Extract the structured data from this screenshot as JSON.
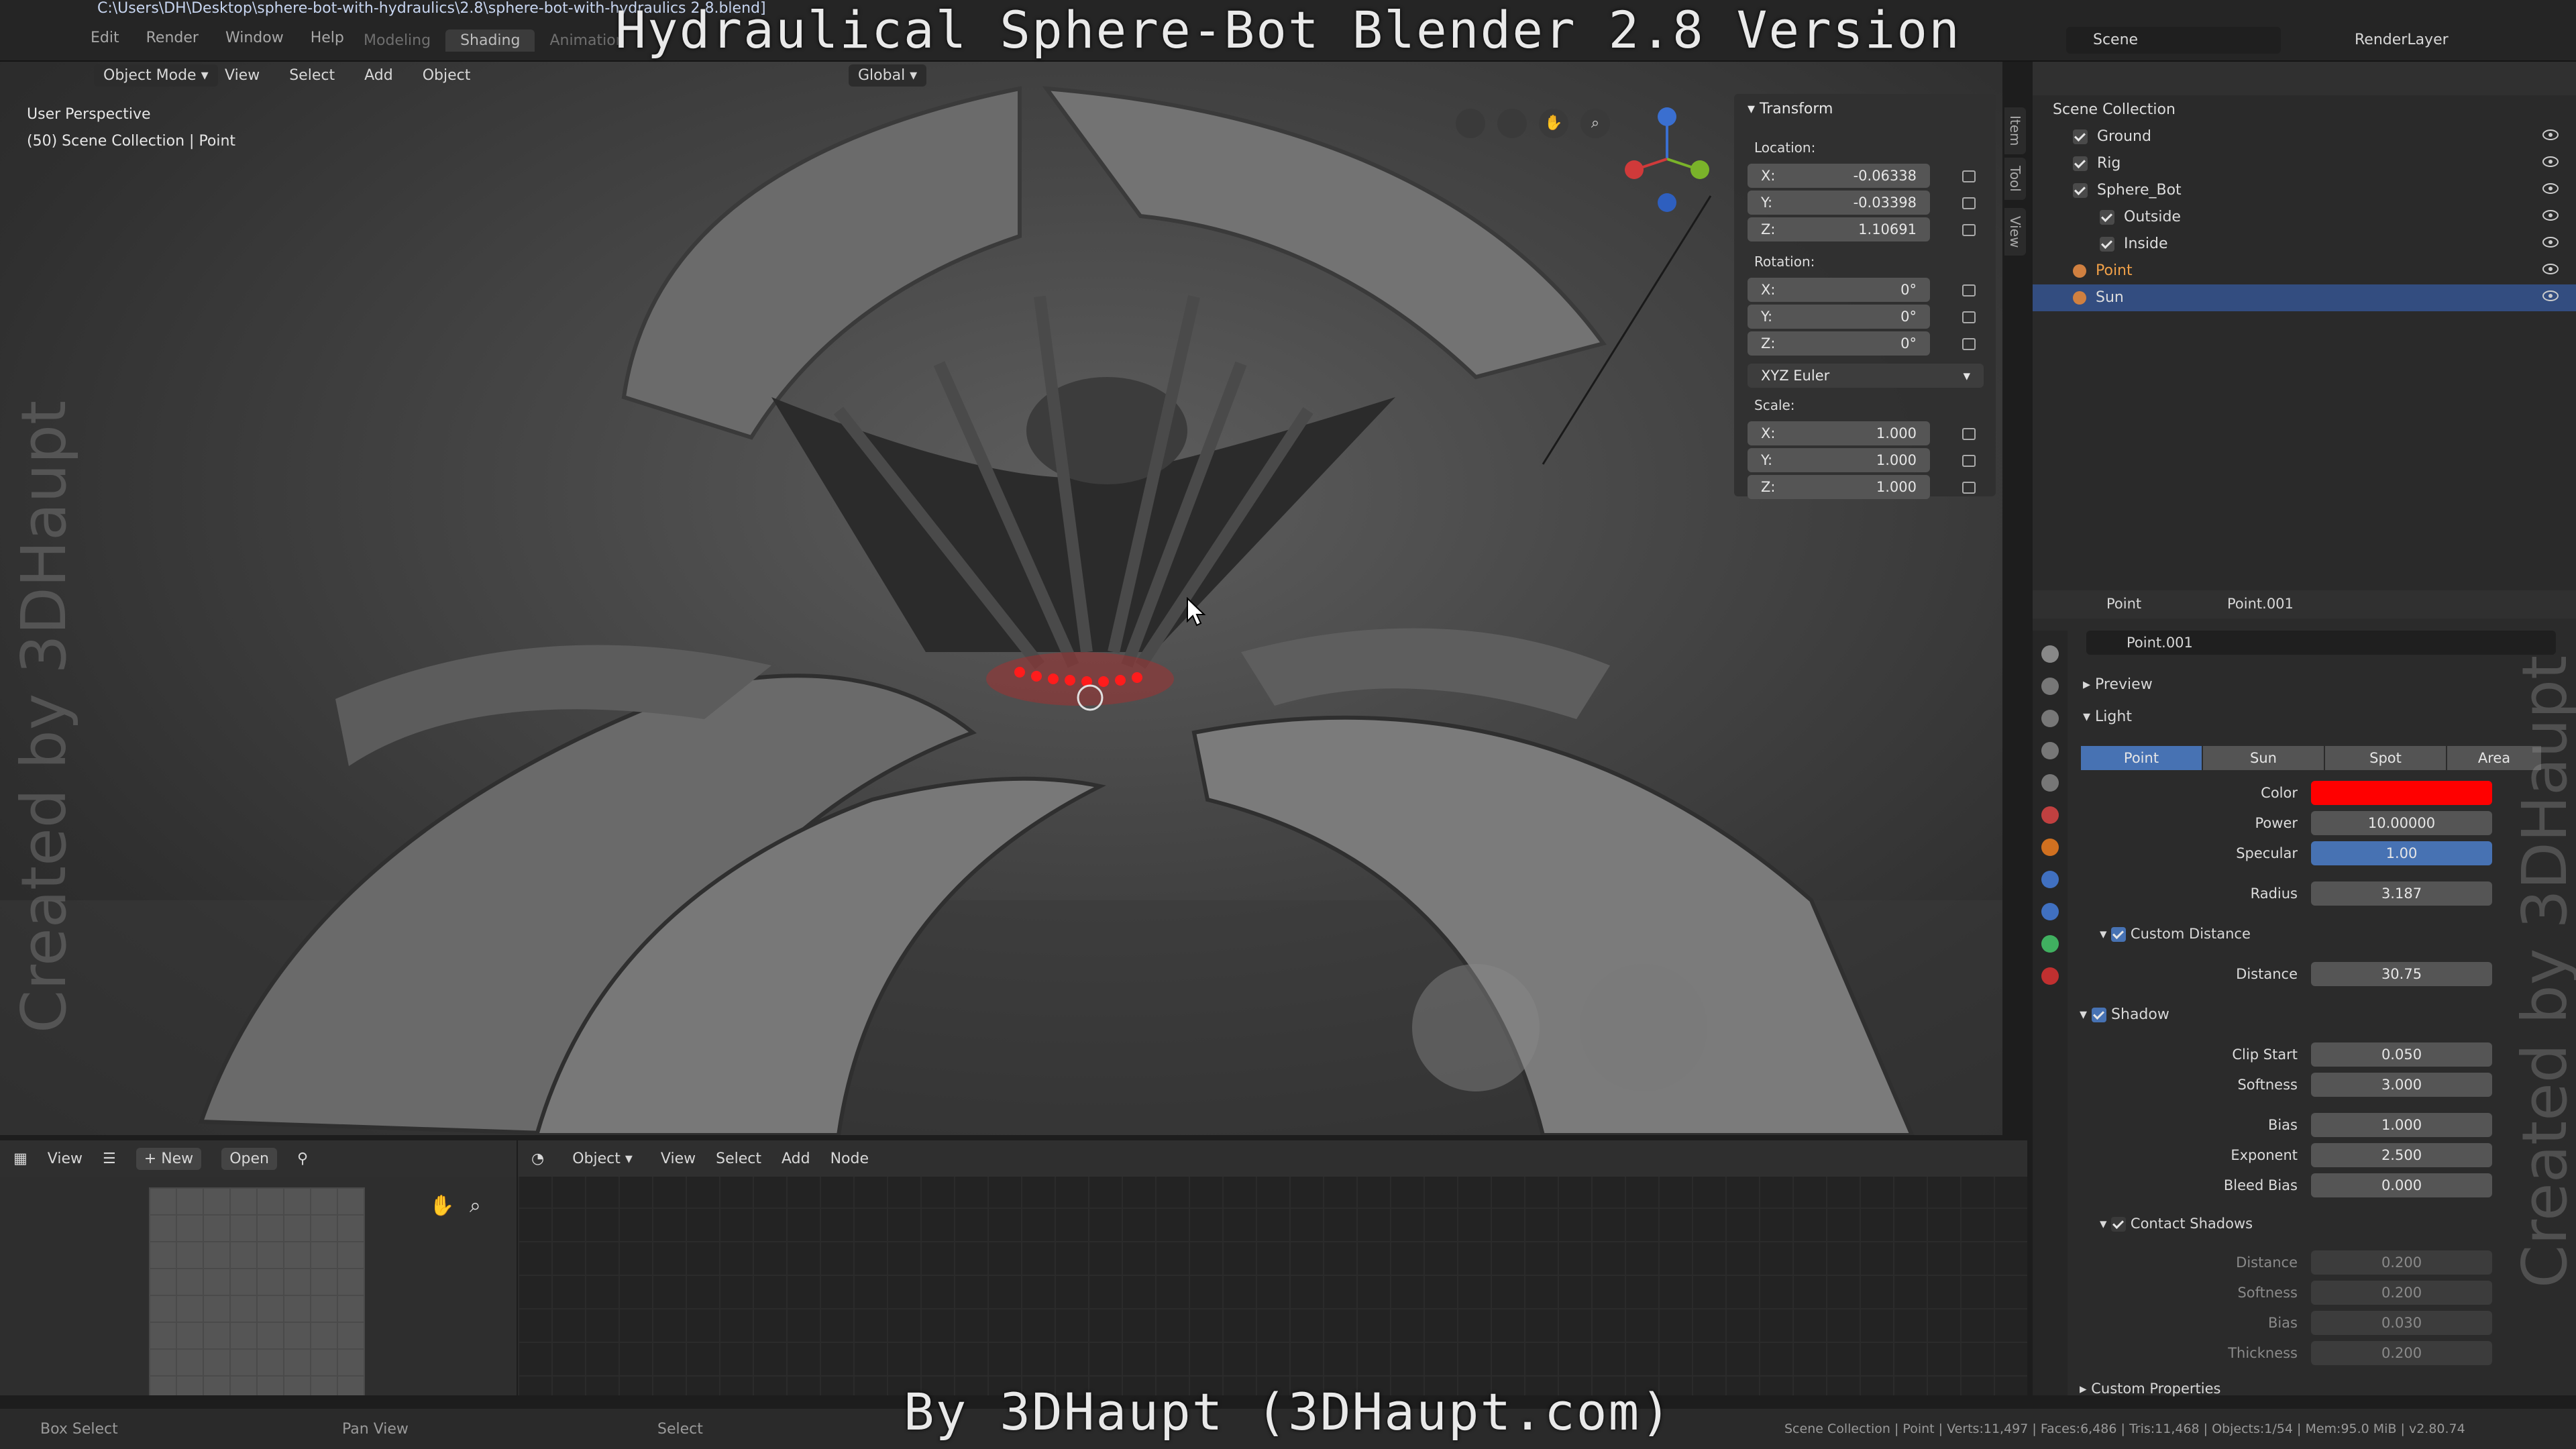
{
  "window": {
    "file_path": "C:\\Users\\DH\\Desktop\\sphere-bot-with-hydraulics\\2.8\\sphere-bot-with-hydraulics 2.8.blend]",
    "menu": [
      "Edit",
      "Render",
      "Window",
      "Help"
    ],
    "workspaces": [
      "Modeling",
      "Shading",
      "Animation"
    ],
    "active_workspace": "Shading",
    "scene": "Scene",
    "render_layer": "RenderLayer"
  },
  "overlay": {
    "title": "Hydraulical Sphere-Bot Blender 2.8 Version",
    "credit": "By 3DHaupt (3DHaupt.com)",
    "watermark_left": "Created by 3DHaupt",
    "watermark_right": "Created by 3DHaupt"
  },
  "viewport": {
    "mode": "Object Mode",
    "menus": [
      "View",
      "Select",
      "Add",
      "Object"
    ],
    "orientation": "Global",
    "perspective": "User Perspective",
    "collection_info": "(50) Scene Collection | Point",
    "side_tabs": [
      "Item",
      "Tool",
      "View"
    ]
  },
  "transform": {
    "header": "Transform",
    "location_label": "Location:",
    "location": [
      {
        "axis": "X:",
        "value": "-0.06338"
      },
      {
        "axis": "Y:",
        "value": "-0.03398"
      },
      {
        "axis": "Z:",
        "value": "1.10691"
      }
    ],
    "rotation_label": "Rotation:",
    "rotation": [
      {
        "axis": "X:",
        "value": "0°"
      },
      {
        "axis": "Y:",
        "value": "0°"
      },
      {
        "axis": "Z:",
        "value": "0°"
      }
    ],
    "rotation_mode": "XYZ Euler",
    "scale_label": "Scale:",
    "scale": [
      {
        "axis": "X:",
        "value": "1.000"
      },
      {
        "axis": "Y:",
        "value": "1.000"
      },
      {
        "axis": "Z:",
        "value": "1.000"
      }
    ]
  },
  "outliner": {
    "root": "Scene Collection",
    "items": [
      "Ground",
      "Rig",
      "Sphere_Bot",
      "Outside",
      "Inside",
      "Point",
      "Sun"
    ],
    "selected": "Sun"
  },
  "properties": {
    "object": "Point",
    "data": "Point.001",
    "datablock": "Point.001",
    "sections": {
      "preview": "Preview",
      "light": "Light"
    },
    "light_types": [
      "Point",
      "Sun",
      "Spot",
      "Area"
    ],
    "active_light_type": "Point",
    "color_label": "Color",
    "color_value": "#ff0000",
    "power_label": "Power",
    "power": "10.00000",
    "specular_label": "Specular",
    "specular": "1.00",
    "radius_label": "Radius",
    "radius": "3.187",
    "custom_distance": "Custom Distance",
    "distance_label": "Distance",
    "distance": "30.75",
    "shadow": "Shadow",
    "clip_start_label": "Clip Start",
    "clip_start": "0.050",
    "softness_label": "Softness",
    "softness": "3.000",
    "bias_label": "Bias",
    "bias": "1.000",
    "exponent_label": "Exponent",
    "exponent": "2.500",
    "bleed_bias_label": "Bleed Bias",
    "bleed_bias": "0.000",
    "contact_shadows": "Contact Shadows",
    "cs_distance_label": "Distance",
    "cs_distance": "0.200",
    "cs_softness_label": "Softness",
    "cs_softness": "0.200",
    "cs_bias_label": "Bias",
    "cs_bias": "0.030",
    "cs_thickness_label": "Thickness",
    "cs_thickness": "0.200",
    "custom_properties": "Custom Properties"
  },
  "image_editor": {
    "menus": [
      "View"
    ],
    "new": "New",
    "open": "Open"
  },
  "node_editor": {
    "type": "Object",
    "menus": [
      "View",
      "Select",
      "Add",
      "Node"
    ]
  },
  "statusbar": {
    "box_select": "Box Select",
    "pan_view": "Pan View",
    "select": "Select",
    "stats": "Scene Collection | Point | Verts:11,497 | Faces:6,486 | Tris:11,468 | Objects:1/54 | Mem:95.0 MiB | v2.80.74"
  }
}
